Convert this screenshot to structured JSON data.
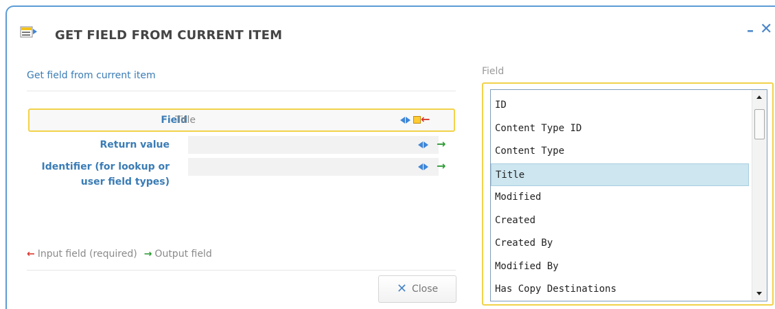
{
  "dialog": {
    "title": "GET FIELD FROM CURRENT ITEM",
    "minimize_glyph": "–",
    "close_glyph": "✕"
  },
  "section": {
    "title": "Get field from current item"
  },
  "form": {
    "rows": [
      {
        "label": "Field",
        "value": "Title",
        "direction": "input",
        "arrow": "←",
        "arrow_color": "#d9362b"
      },
      {
        "label": "Return value",
        "value": "",
        "direction": "output",
        "arrow": "→",
        "arrow_color": "#2e9b36"
      },
      {
        "label_line1": "Identifier (for lookup or",
        "label_line2": "user field types)",
        "value": "",
        "direction": "output",
        "arrow": "→",
        "arrow_color": "#2e9b36"
      }
    ]
  },
  "legend": {
    "input_arrow": "←",
    "input_label": "Input field (required)",
    "output_arrow": "→",
    "output_label": "Output field"
  },
  "buttons": {
    "close_label": "Close",
    "close_icon": "✕"
  },
  "field_panel": {
    "heading": "Field",
    "selected_index": 3,
    "items": [
      "ID",
      "Content Type ID",
      "Content Type",
      "Title",
      "Modified",
      "Created",
      "Created By",
      "Modified By",
      "Has Copy Destinations"
    ]
  },
  "colors": {
    "accent_blue": "#3a7cb5",
    "highlight_yellow": "#f2d24a",
    "input_arrow_red": "#d9362b",
    "output_arrow_green": "#2e9b36",
    "selected_row": "#cde6f0"
  },
  "icons": {
    "header": "workflow-action-icon",
    "lookup": "lookup-arrows-icon",
    "clear": "yellow-square-icon"
  }
}
